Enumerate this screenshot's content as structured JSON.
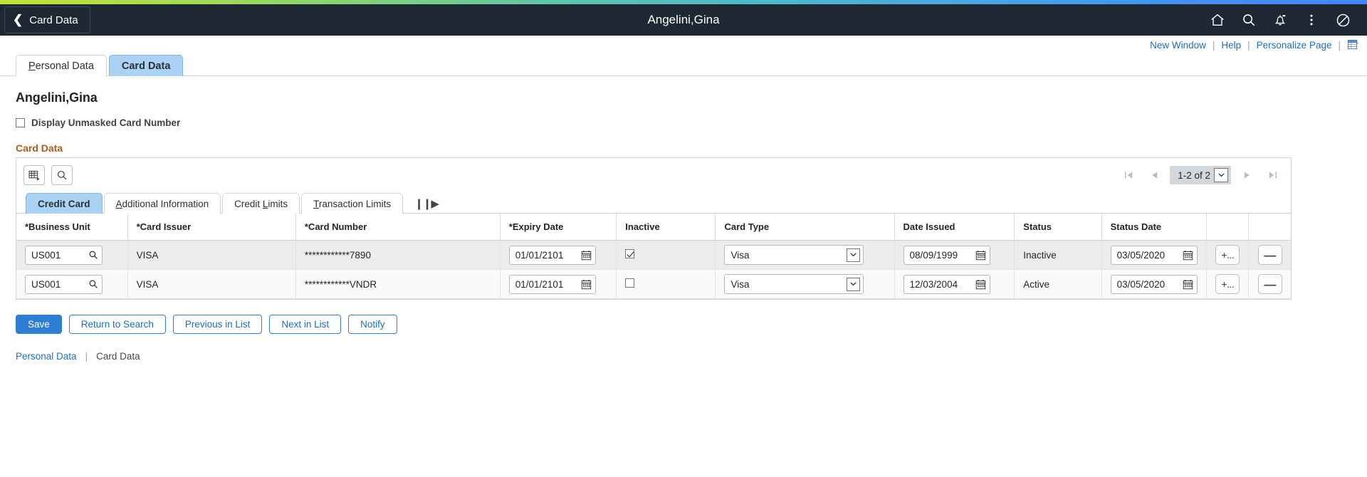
{
  "header": {
    "back_label": "Card Data",
    "title": "Angelini,Gina",
    "icons": [
      "home-icon",
      "search-icon",
      "notification-bell-icon",
      "actions-menu-icon",
      "nav-bar-icon"
    ]
  },
  "links_bar": {
    "new_window": "New Window",
    "help": "Help",
    "personalize_page": "Personalize Page",
    "separator": "|",
    "grid_icon": "page-layout-icon"
  },
  "page_tabs": [
    {
      "label": "Personal Data",
      "accesskey": "P",
      "active": false
    },
    {
      "label": "Card Data",
      "accesskey": "",
      "active": true
    }
  ],
  "main": {
    "page_title": "Angelini,Gina",
    "unmask_checkbox": {
      "label": "Display Unmasked Card Number",
      "checked": false
    },
    "group_label": "Card Data"
  },
  "grid_toolbar": {
    "personalize_icon": "grid-personalize-icon",
    "find_icon": "search-icon",
    "pager": {
      "first": "first-page-icon",
      "prev": "previous-page-icon",
      "count": "1-2 of 2",
      "dropdown": "chevron-down-icon",
      "next": "next-page-icon",
      "last": "last-page-icon"
    }
  },
  "inner_tabs": [
    {
      "label": "Credit Card",
      "accesskey": "",
      "active": true
    },
    {
      "label": "Additional Information",
      "accesskey": "A",
      "active": false
    },
    {
      "label": "Credit Limits",
      "accesskey": "L",
      "active": false
    },
    {
      "label": "Transaction Limits",
      "accesskey": "T",
      "active": false
    }
  ],
  "expand_all_icon": "❙❙▶",
  "table": {
    "columns": [
      "*Business Unit",
      "*Card Issuer",
      "*Card Number",
      "*Expiry Date",
      "Inactive",
      "Card Type",
      "Date Issued",
      "Status",
      "Status Date",
      "",
      ""
    ],
    "rows": [
      {
        "business_unit": "US001",
        "card_issuer": "VISA",
        "card_number": "************7890",
        "expiry_date": "01/01/2101",
        "inactive": true,
        "card_type": "Visa",
        "date_issued": "08/09/1999",
        "status": "Inactive",
        "status_date": "03/05/2020",
        "add_label": "+...",
        "delete_label": "—"
      },
      {
        "business_unit": "US001",
        "card_issuer": "VISA",
        "card_number": "************VNDR",
        "expiry_date": "01/01/2101",
        "inactive": false,
        "card_type": "Visa",
        "date_issued": "12/03/2004",
        "status": "Active",
        "status_date": "03/05/2020",
        "add_label": "+...",
        "delete_label": "—"
      }
    ]
  },
  "actions": [
    {
      "label": "Save",
      "primary": true
    },
    {
      "label": "Return to Search",
      "primary": false
    },
    {
      "label": "Previous in List",
      "primary": false
    },
    {
      "label": "Next in List",
      "primary": false
    },
    {
      "label": "Notify",
      "primary": false
    }
  ],
  "footer": {
    "link": "Personal Data",
    "separator": "|",
    "current": "Card Data"
  },
  "colors": {
    "header_bg": "#1d2833",
    "accent_blue": "#2e7fd4",
    "link_blue": "#1c6fc4",
    "active_tab": "#a9d2f5",
    "group_label": "#b05a1b",
    "row_alt": "#ececec"
  }
}
